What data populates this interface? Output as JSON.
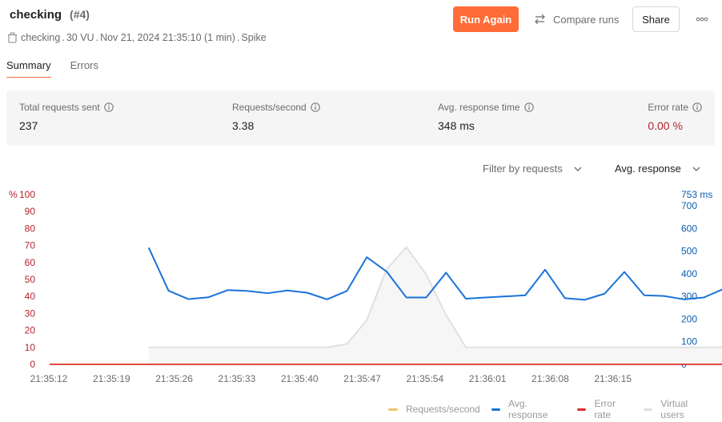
{
  "header": {
    "title": "checking",
    "run_number": "(#4)",
    "meta": {
      "collection": "checking",
      "vu": "30 VU",
      "datetime": "Nov 21, 2024 21:35:10 (1 min)",
      "profile": "Spike"
    },
    "run_again_label": "Run Again",
    "compare_label": "Compare runs",
    "share_label": "Share"
  },
  "tabs": [
    {
      "label": "Summary",
      "active": true
    },
    {
      "label": "Errors",
      "active": false
    }
  ],
  "summary": {
    "total_requests": {
      "label": "Total requests sent",
      "value": "237"
    },
    "rps": {
      "label": "Requests/second",
      "value": "3.38"
    },
    "avg_response": {
      "label": "Avg. response time",
      "value": "348 ms"
    },
    "error_rate": {
      "label": "Error rate",
      "value": "0.00 %"
    }
  },
  "filters": {
    "requests_label": "Filter by requests",
    "metric_label": "Avg. response"
  },
  "colors": {
    "accent": "#ff6c37",
    "avg_response": "#1a73d9",
    "error_rate": "#d93025",
    "virtual_users": "#e0e0e0",
    "requests_per_second": "#f5c26b",
    "left_axis_text": "#b4232c",
    "right_axis_text": "#0b5cad"
  },
  "chart_data": {
    "type": "line",
    "x_ticks": [
      "21:35:12",
      "21:35:19",
      "21:35:26",
      "21:35:33",
      "21:35:40",
      "21:35:47",
      "21:35:54",
      "21:36:01",
      "21:36:08",
      "21:36:15"
    ],
    "left_axis": {
      "label": "%",
      "ticks": [
        "100",
        "90",
        "80",
        "70",
        "60",
        "50",
        "40",
        "30",
        "20",
        "10",
        "0"
      ],
      "ylim": [
        0,
        100
      ]
    },
    "right_axis": {
      "label": "753 ms",
      "ticks": [
        "700",
        "600",
        "500",
        "400",
        "300",
        "200",
        "100",
        "0"
      ],
      "ylim": [
        0,
        753
      ]
    },
    "x_range": [
      0,
      63
    ],
    "series": [
      {
        "name": "Avg. response",
        "axis": "right",
        "x": [
          10,
          12,
          14,
          16,
          18,
          20,
          22,
          24,
          26,
          28,
          30,
          32,
          34,
          36,
          38,
          40,
          42,
          44,
          46,
          48,
          50,
          52,
          54,
          56,
          58,
          60,
          62,
          64,
          66,
          68
        ],
        "values": [
          515,
          325,
          288,
          296,
          328,
          324,
          314,
          326,
          316,
          287,
          324,
          473,
          410,
          295,
          295,
          405,
          290,
          295,
          300,
          305,
          418,
          292,
          285,
          312,
          408,
          305,
          302,
          287,
          295,
          333
        ]
      },
      {
        "name": "Virtual users",
        "axis": "left",
        "x": [
          10,
          12,
          14,
          16,
          18,
          20,
          22,
          24,
          26,
          28,
          30,
          32,
          34,
          36,
          38,
          40,
          42,
          44,
          46,
          48,
          50,
          52,
          54,
          56,
          58,
          60,
          62,
          64,
          66,
          68
        ],
        "values": [
          10,
          10,
          10,
          10,
          10,
          10,
          10,
          10,
          10,
          10,
          12,
          26,
          56,
          69,
          53,
          29,
          10,
          10,
          10,
          10,
          10,
          10,
          10,
          10,
          10,
          10,
          10,
          10,
          10,
          10
        ]
      },
      {
        "name": "Error rate",
        "axis": "left",
        "x": [
          0,
          68
        ],
        "values": [
          0,
          0
        ]
      }
    ],
    "legend": [
      "Requests/second",
      "Avg. response",
      "Error rate",
      "Virtual users"
    ],
    "legend_position": "bottom-right"
  }
}
